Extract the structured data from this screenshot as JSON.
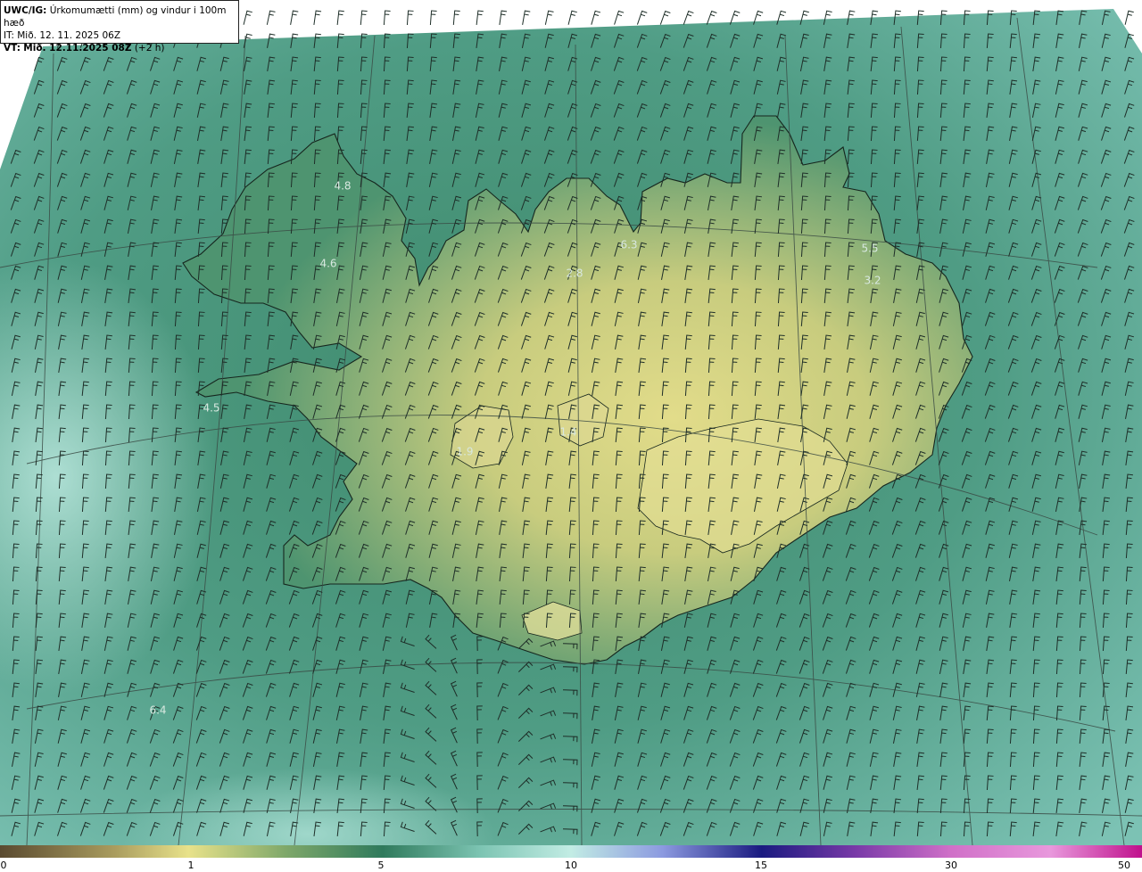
{
  "title": {
    "model": "UWC/IG:",
    "field": "Úrkomumætti (mm) og vindur i 100m hæð",
    "it_label": "IT:",
    "it_value": "Mið. 12. 11. 2025 06Z",
    "vt_label": "VT:",
    "vt_value": "Mið. 12.11.2025 08Z",
    "vt_offset": "(+2 h)"
  },
  "value_labels": [
    {
      "text": "4.8",
      "pos": [
        384,
        209
      ]
    },
    {
      "text": "4.6",
      "pos": [
        368,
        296
      ]
    },
    {
      "text": "6.3",
      "pos": [
        705,
        275
      ]
    },
    {
      "text": "2.8",
      "pos": [
        644,
        307
      ]
    },
    {
      "text": "5.5",
      "pos": [
        975,
        279
      ]
    },
    {
      "text": "3.2",
      "pos": [
        978,
        315
      ]
    },
    {
      "text": "4.5",
      "pos": [
        237,
        458
      ]
    },
    {
      "text": "6.4",
      "pos": [
        177,
        797
      ]
    },
    {
      "text": "1.4",
      "pos": [
        637,
        485
      ]
    },
    {
      "text": "1.9",
      "pos": [
        521,
        507
      ]
    }
  ],
  "colorbar": {
    "ticks": [
      "0",
      "1",
      "5",
      "10",
      "15",
      "30",
      "50"
    ],
    "colors": {
      "dry": "#5a4a30",
      "low": "#e8e28a",
      "mid": "#2f7a5c",
      "high": "#b6e8e0",
      "heavy": "#1a1a80",
      "extreme": "#c0108c"
    }
  },
  "map_colors": {
    "ocean": "#6fb5a6",
    "ocean_light": "#a8ddd2",
    "land_wet": "#3f8a68",
    "land_dry": "#e0dc8c",
    "coast": "#1a2a22",
    "grid": "#3a4a44"
  }
}
